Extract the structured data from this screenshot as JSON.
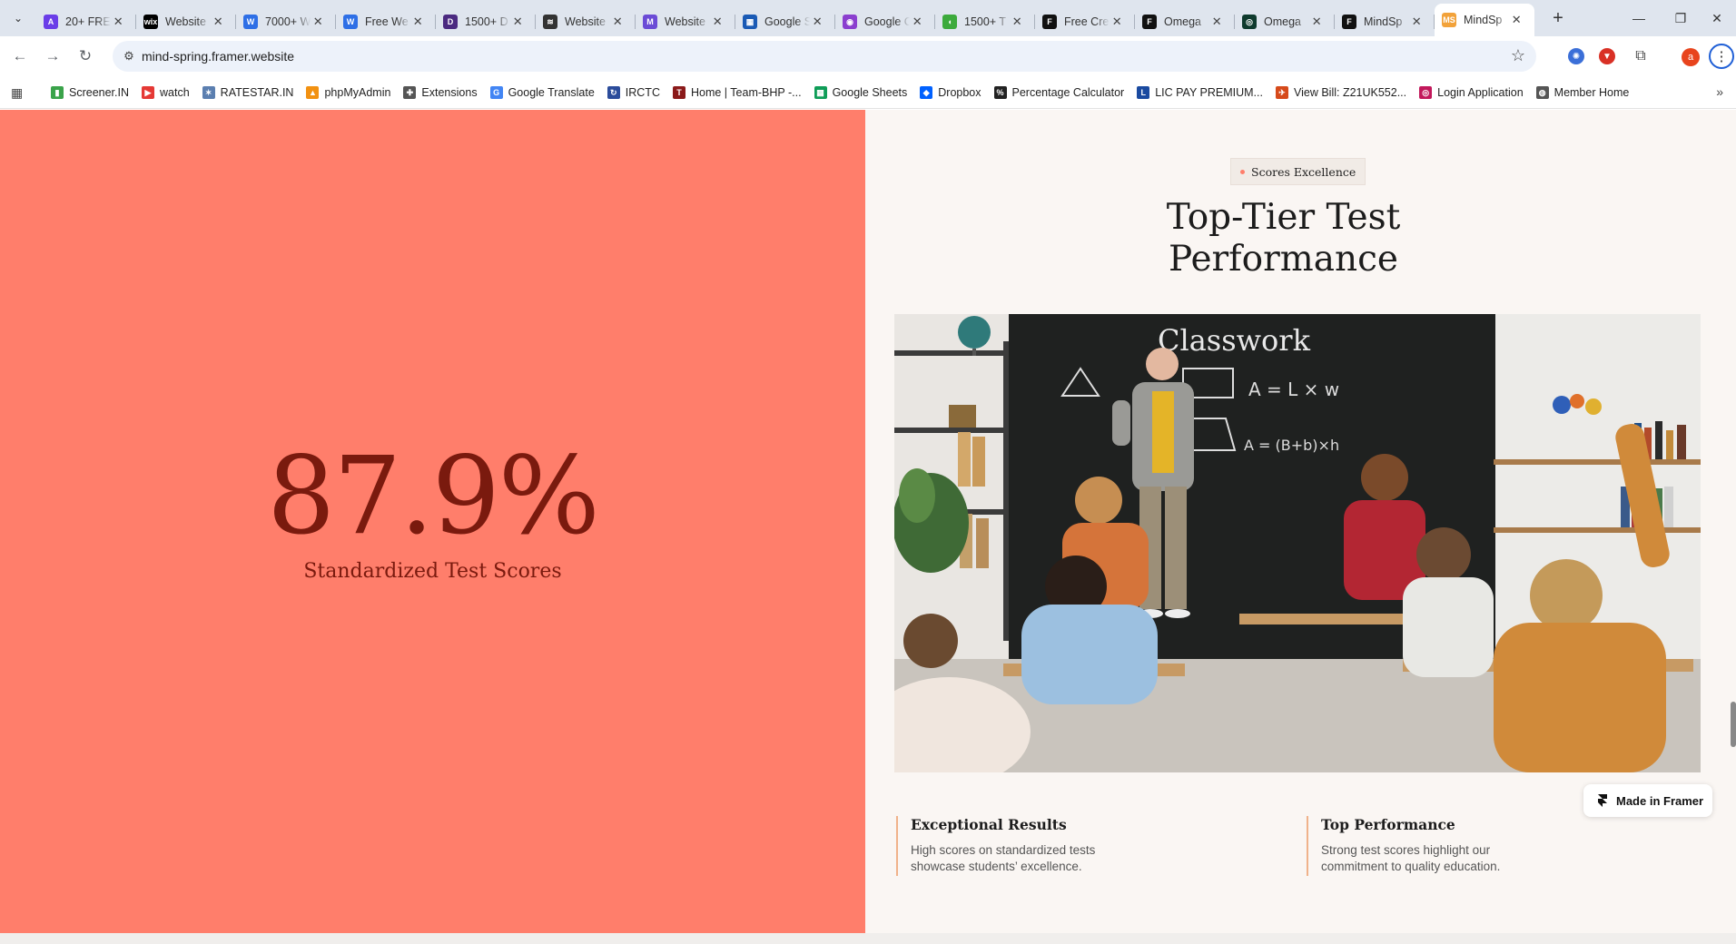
{
  "browser": {
    "tabs": [
      {
        "title": "20+ FREE",
        "favicon_color": "#6a3de8",
        "favicon_glyph": "A"
      },
      {
        "title": "Website",
        "favicon_color": "#000000",
        "favicon_glyph": "wix"
      },
      {
        "title": "7000+ W",
        "favicon_color": "#2e6fe6",
        "favicon_glyph": "W"
      },
      {
        "title": "Free We",
        "favicon_color": "#2e6fe6",
        "favicon_glyph": "W"
      },
      {
        "title": "1500+ D",
        "favicon_color": "#4b2a80",
        "favicon_glyph": "D"
      },
      {
        "title": "Website",
        "favicon_color": "#333333",
        "favicon_glyph": "≋"
      },
      {
        "title": "Website",
        "favicon_color": "#6b4bd6",
        "favicon_glyph": "M"
      },
      {
        "title": "Google S",
        "favicon_color": "#1a5ab5",
        "favicon_glyph": "▦"
      },
      {
        "title": "Google C",
        "favicon_color": "#8b3fcf",
        "favicon_glyph": "◉"
      },
      {
        "title": "1500+ T",
        "favicon_color": "#3caa3c",
        "favicon_glyph": "◖"
      },
      {
        "title": "Free Cre",
        "favicon_color": "#111111",
        "favicon_glyph": "F"
      },
      {
        "title": "Omega",
        "favicon_color": "#111111",
        "favicon_glyph": "F"
      },
      {
        "title": "Omega",
        "favicon_color": "#0f3b2e",
        "favicon_glyph": "◎"
      },
      {
        "title": "MindSp",
        "favicon_color": "#111111",
        "favicon_glyph": "F"
      },
      {
        "title": "MindSp",
        "favicon_color": "#f2a23a",
        "favicon_glyph": "MS",
        "active": true
      }
    ],
    "url": "mind-spring.framer.website",
    "profile_initial": "a",
    "bookmarks": [
      {
        "label": "Screener.IN",
        "color": "#3aa34a",
        "glyph": "▮"
      },
      {
        "label": "watch",
        "color": "#e53935",
        "glyph": "▶"
      },
      {
        "label": "RATESTAR.IN",
        "color": "#5b7fb0",
        "glyph": "✶"
      },
      {
        "label": "phpMyAdmin",
        "color": "#f29111",
        "glyph": "▲"
      },
      {
        "label": "Extensions",
        "color": "#555555",
        "glyph": "✚"
      },
      {
        "label": "Google Translate",
        "color": "#4285f4",
        "glyph": "G"
      },
      {
        "label": "IRCTC",
        "color": "#2b4c9b",
        "glyph": "↻"
      },
      {
        "label": "Home | Team-BHP -...",
        "color": "#8b1a1a",
        "glyph": "T"
      },
      {
        "label": "Google Sheets",
        "color": "#0f9d58",
        "glyph": "▦"
      },
      {
        "label": "Dropbox",
        "color": "#0061ff",
        "glyph": "◆"
      },
      {
        "label": "Percentage Calculator",
        "color": "#222222",
        "glyph": "%"
      },
      {
        "label": "LIC PAY PREMIUM...",
        "color": "#1a4aa0",
        "glyph": "L"
      },
      {
        "label": "View Bill: Z21UK552...",
        "color": "#d64a1a",
        "glyph": "✈"
      },
      {
        "label": "Login Application",
        "color": "#c2185b",
        "glyph": "◎"
      },
      {
        "label": "Member Home",
        "color": "#555555",
        "glyph": "◍"
      }
    ]
  },
  "page": {
    "stat_value": "87.9%",
    "stat_label": "Standardized Test Scores",
    "badge_label": "Scores Excellence",
    "heading_line1": "Top-Tier Test",
    "heading_line2": "Performance",
    "chalkboard_title": "Classwork",
    "chalk_formula_1": "A = L × w",
    "chalk_formula_2": "A = (B+b)×h",
    "features": [
      {
        "title": "Exceptional Results",
        "text": "High scores on standardized tests showcase students’ excellence."
      },
      {
        "title": "Top Performance",
        "text": "Strong test scores highlight our commitment to quality education."
      }
    ],
    "framer_badge": "Made in Framer",
    "colors": {
      "accent": "#ff7e6b",
      "stat_text": "#7a1a0e",
      "page_bg": "#faf6f3"
    }
  }
}
